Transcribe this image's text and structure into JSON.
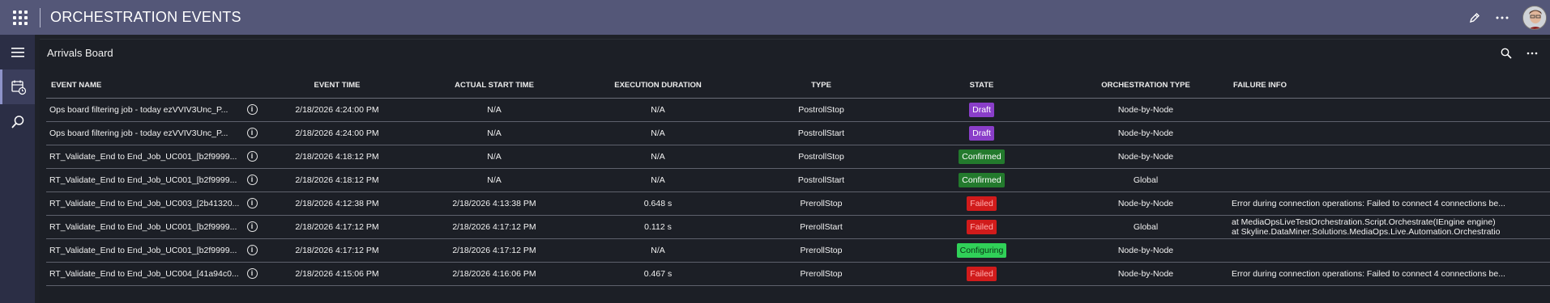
{
  "header": {
    "title": "ORCHESTRATION EVENTS"
  },
  "panel": {
    "title": "Arrivals Board"
  },
  "table": {
    "columns": [
      "EVENT NAME",
      "",
      "EVENT TIME",
      "ACTUAL START TIME",
      "EXECUTION DURATION",
      "TYPE",
      "STATE",
      "ORCHESTRATION TYPE",
      "FAILURE INFO"
    ],
    "rows": [
      {
        "name": "Ops board filtering job - today ezVVIV3Unc_P...",
        "event_time": "2/18/2026 4:24:00 PM",
        "start": "N/A",
        "duration": "N/A",
        "type": "PostrollStop",
        "state": "Draft",
        "state_kind": "draft",
        "orch": "Node-by-Node",
        "failure": "",
        "failure2": ""
      },
      {
        "name": "Ops board filtering job - today ezVVIV3Unc_P...",
        "event_time": "2/18/2026 4:24:00 PM",
        "start": "N/A",
        "duration": "N/A",
        "type": "PostrollStart",
        "state": "Draft",
        "state_kind": "draft",
        "orch": "Node-by-Node",
        "failure": "",
        "failure2": ""
      },
      {
        "name": "RT_Validate_End to End_Job_UC001_[b2f9999...",
        "event_time": "2/18/2026 4:18:12 PM",
        "start": "N/A",
        "duration": "N/A",
        "type": "PostrollStop",
        "state": "Confirmed",
        "state_kind": "confirmed",
        "orch": "Node-by-Node",
        "failure": "",
        "failure2": ""
      },
      {
        "name": "RT_Validate_End to End_Job_UC001_[b2f9999...",
        "event_time": "2/18/2026 4:18:12 PM",
        "start": "N/A",
        "duration": "N/A",
        "type": "PostrollStart",
        "state": "Confirmed",
        "state_kind": "confirmed",
        "orch": "Global",
        "failure": "",
        "failure2": ""
      },
      {
        "name": "RT_Validate_End to End_Job_UC003_[2b41320...",
        "event_time": "2/18/2026 4:12:38 PM",
        "start": "2/18/2026 4:13:38 PM",
        "duration": "0.648 s",
        "type": "PrerollStop",
        "state": "Failed",
        "state_kind": "failed",
        "orch": "Node-by-Node",
        "failure": "Error during connection operations: Failed to connect 4 connections be...",
        "failure2": ""
      },
      {
        "name": "RT_Validate_End to End_Job_UC001_[b2f9999...",
        "event_time": "2/18/2026 4:17:12 PM",
        "start": "2/18/2026 4:17:12 PM",
        "duration": "0.112 s",
        "type": "PrerollStart",
        "state": "Failed",
        "state_kind": "failed",
        "orch": "Global",
        "failure": "at MediaOpsLiveTestOrchestration.Script.Orchestrate(IEngine engine)",
        "failure2": "at Skyline.DataMiner.Solutions.MediaOps.Live.Automation.Orchestratio"
      },
      {
        "name": "RT_Validate_End to End_Job_UC001_[b2f9999...",
        "event_time": "2/18/2026 4:17:12 PM",
        "start": "2/18/2026 4:17:12 PM",
        "duration": "N/A",
        "type": "PrerollStop",
        "state": "Configuring",
        "state_kind": "configuring",
        "orch": "Node-by-Node",
        "failure": "",
        "failure2": ""
      },
      {
        "name": "RT_Validate_End to End_Job_UC004_[41a94c0...",
        "event_time": "2/18/2026 4:15:06 PM",
        "start": "2/18/2026 4:16:06 PM",
        "duration": "0.467 s",
        "type": "PrerollStop",
        "state": "Failed",
        "state_kind": "failed",
        "orch": "Node-by-Node",
        "failure": "Error during connection operations: Failed to connect 4 connections be...",
        "failure2": ""
      }
    ]
  },
  "colors": {
    "header": "#545778",
    "sidebar": "#2b2e45",
    "background": "#1c1f26",
    "draft": "#8a3ec9",
    "confirmed": "#237a2d",
    "failed": "#d11b1b",
    "configuring": "#30d158"
  },
  "icons": [
    "apps-grid-icon",
    "pencil-icon",
    "more-icon",
    "hamburger-menu-icon",
    "calendar-clock-icon",
    "search-icon",
    "info-icon"
  ]
}
